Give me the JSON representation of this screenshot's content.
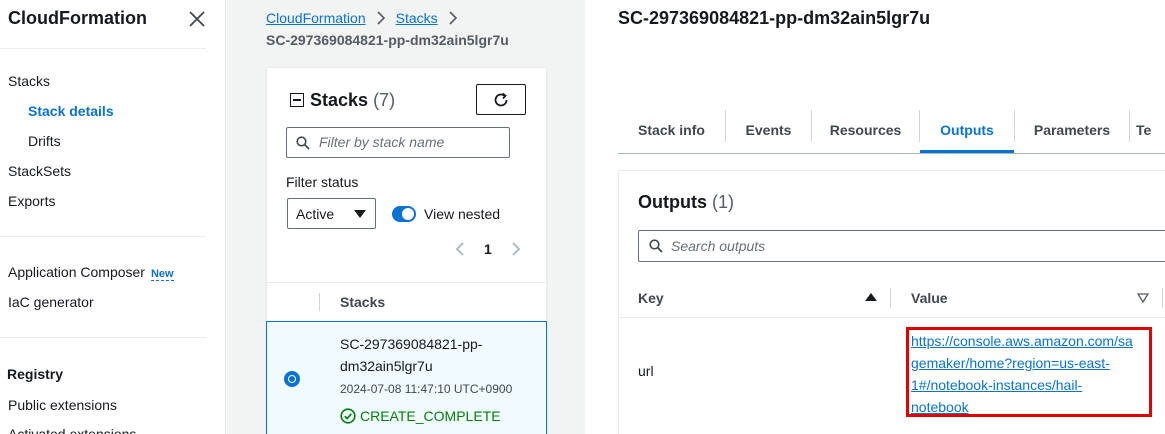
{
  "nav": {
    "title": "CloudFormation",
    "items": {
      "stacks": "Stacks",
      "stack_details": "Stack details",
      "drifts": "Drifts",
      "stacksets": "StackSets",
      "exports": "Exports",
      "application_composer": "Application Composer",
      "new_badge": "New",
      "iac_generator": "IaC generator",
      "registry": "Registry",
      "public_extensions": "Public extensions",
      "activated_extensions": "Activated extensions"
    }
  },
  "breadcrumb": {
    "items": [
      "CloudFormation",
      "Stacks"
    ],
    "current": "SC-297369084821-pp-dm32ain5lgr7u"
  },
  "stacks_panel": {
    "title": "Stacks",
    "count": "(7)",
    "filter_placeholder": "Filter by stack name",
    "filter_status_label": "Filter status",
    "filter_status_value": "Active",
    "view_nested_label": "View nested",
    "view_nested_on": true,
    "page": "1",
    "column_header": "Stacks",
    "rows": [
      {
        "name": "SC-297369084821-pp-dm32ain5lgr7u",
        "name_line1": "SC-297369084821-pp-",
        "name_line2": "dm32ain5lgr7u",
        "created": "2024-07-08 11:47:10 UTC+0900",
        "status": "CREATE_COMPLETE",
        "selected": true
      }
    ]
  },
  "detail": {
    "title": "SC-297369084821-pp-dm32ain5lgr7u",
    "tabs": [
      "Stack info",
      "Events",
      "Resources",
      "Outputs",
      "Parameters",
      "Te"
    ],
    "active_tab": "Outputs"
  },
  "outputs": {
    "title": "Outputs",
    "count": "(1)",
    "search_placeholder": "Search outputs",
    "columns": {
      "key": "Key",
      "value": "Value"
    },
    "rows": [
      {
        "key": "url",
        "value_lines": [
          "https://console.aws.amazon.com/sa",
          "gemaker/home?region=us-east-",
          "1#/notebook-instances/hail-",
          "notebook"
        ]
      }
    ]
  },
  "colors": {
    "accent": "#0972d3",
    "success": "#037f0c",
    "highlight": "#e00000",
    "background_panel": "#f2f3f3"
  }
}
